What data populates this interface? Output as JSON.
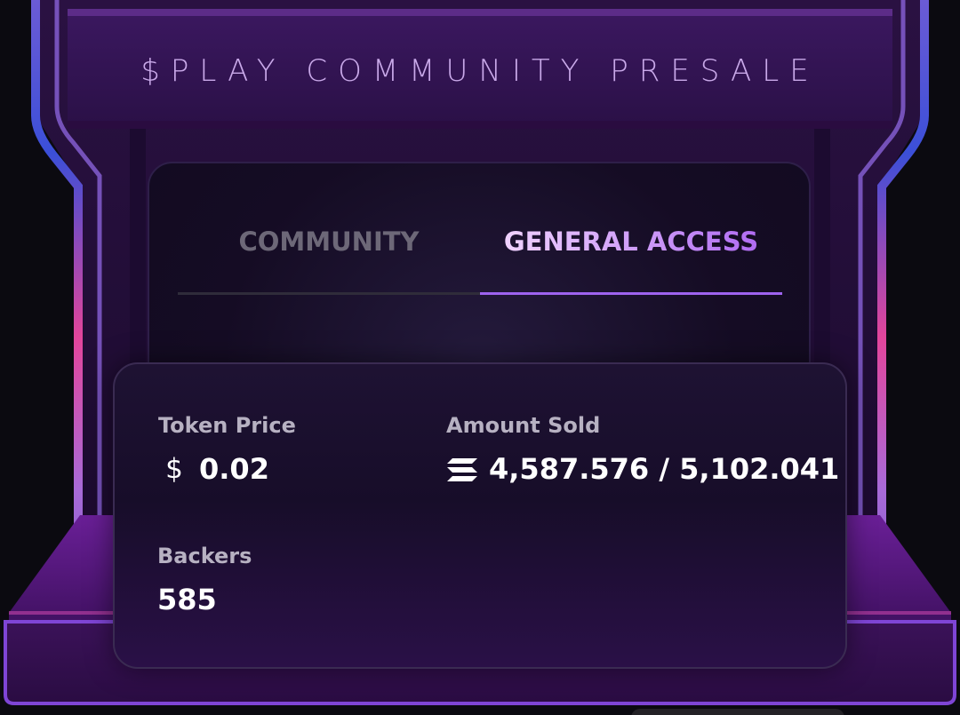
{
  "marquee": {
    "title": "$PLAY COMMUNITY PRESALE"
  },
  "tabs": [
    {
      "label": "COMMUNITY",
      "active": false
    },
    {
      "label": "GENERAL ACCESS",
      "active": true
    }
  ],
  "stats": {
    "token_price": {
      "label": "Token Price",
      "currency_icon": "dollar-icon",
      "value": "0.02"
    },
    "amount_sold": {
      "label": "Amount Sold",
      "currency_icon": "solana-icon",
      "value": "4,587.576 / 5,102.041"
    },
    "backers": {
      "label": "Backers",
      "value": "585"
    }
  },
  "colors": {
    "background": "#0b0a10",
    "accent_purple": "#9e63ef",
    "neon_blue": "#3b4fd8",
    "neon_pink": "#e2459b",
    "cabinet_purple": "#4a1470",
    "inactive_tab": "#6d6878",
    "label_gray": "#b7b1c2"
  }
}
